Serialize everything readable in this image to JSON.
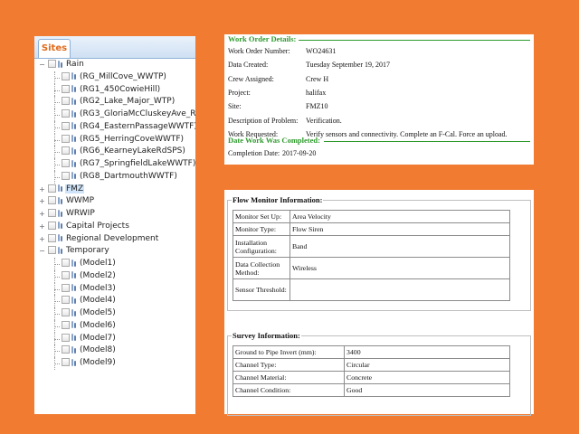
{
  "tree_panel": {
    "tab_label": "Sites",
    "nodes": [
      {
        "label": "Rain",
        "kind": "root",
        "expander": "−"
      },
      {
        "label": "(RG_MillCove_WWTP)",
        "kind": "child"
      },
      {
        "label": "(RG1_450CowieHill)",
        "kind": "child"
      },
      {
        "label": "(RG2_Lake_Major_WTP)",
        "kind": "child"
      },
      {
        "label": "(RG3_GloriaMcCluskeyAve_Re",
        "kind": "child"
      },
      {
        "label": "(RG4_EasternPassageWWTF)",
        "kind": "child"
      },
      {
        "label": "(RG5_HerringCoveWWTF)",
        "kind": "child"
      },
      {
        "label": "(RG6_KearneyLakeRdSPS)",
        "kind": "child"
      },
      {
        "label": "(RG7_SpringfieldLakeWWTF)",
        "kind": "child"
      },
      {
        "label": "(RG8_DartmouthWWTF)",
        "kind": "child"
      },
      {
        "label": "FMZ",
        "kind": "root",
        "expander": "+",
        "selected": true
      },
      {
        "label": "WWMP",
        "kind": "root",
        "expander": "+"
      },
      {
        "label": "WRWIP",
        "kind": "root",
        "expander": "+"
      },
      {
        "label": "Capital Projects",
        "kind": "root",
        "expander": "+"
      },
      {
        "label": "Regional Development",
        "kind": "root",
        "expander": "+"
      },
      {
        "label": "Temporary",
        "kind": "root",
        "expander": "−"
      },
      {
        "label": "(Model1)",
        "kind": "child"
      },
      {
        "label": "(Model2)",
        "kind": "child"
      },
      {
        "label": "(Model3)",
        "kind": "child"
      },
      {
        "label": "(Model4)",
        "kind": "child"
      },
      {
        "label": "(Model5)",
        "kind": "child"
      },
      {
        "label": "(Model6)",
        "kind": "child"
      },
      {
        "label": "(Model7)",
        "kind": "child"
      },
      {
        "label": "(Model8)",
        "kind": "child"
      },
      {
        "label": "(Model9)",
        "kind": "child"
      }
    ]
  },
  "work_order": {
    "title": "Work Order Details:",
    "rows": [
      {
        "key": "Work Order Number:",
        "value": "WO24631"
      },
      {
        "key": "Data Created:",
        "value": "Tuesday September 19, 2017"
      },
      {
        "key": "Crew Assigned:",
        "value": "Crew H"
      },
      {
        "key": "Project:",
        "value": "halifax"
      },
      {
        "key": "Site:",
        "value": "FMZ10"
      },
      {
        "key": "Description of Problem:",
        "value": "Verification."
      },
      {
        "key": "Work Requested:",
        "value": "Verify sensors and connectivity. Complete an F-Cal. Force an upload."
      }
    ],
    "completed_title": "Date Work Was Completed:",
    "completion": {
      "key": "Completion Date:",
      "value": "2017-09-20"
    }
  },
  "flow_monitor": {
    "legend": "Flow Monitor Information:",
    "rows": [
      {
        "key": "Monitor Set Up:",
        "value": "Area Velocity"
      },
      {
        "key": "Monitor Type:",
        "value": "Flow Siren"
      },
      {
        "key": "Installation Configuration:",
        "value": "Band"
      },
      {
        "key": "Data Collection Method:",
        "value": "Wireless"
      },
      {
        "key": "Sensor Threshold:",
        "value": ""
      }
    ]
  },
  "survey": {
    "legend": "Survey Information:",
    "rows": [
      {
        "key": "Ground to Pipe Invert (mm):",
        "value": "3400"
      },
      {
        "key": "Channel Type:",
        "value": "Circular"
      },
      {
        "key": "Channel Material:",
        "value": "Concrete"
      },
      {
        "key": "Channel Condition:",
        "value": "Good"
      }
    ]
  },
  "colors": {
    "background": "#f07b31",
    "section_green": "#2e9a2e",
    "tab_orange": "#e06a1a"
  }
}
